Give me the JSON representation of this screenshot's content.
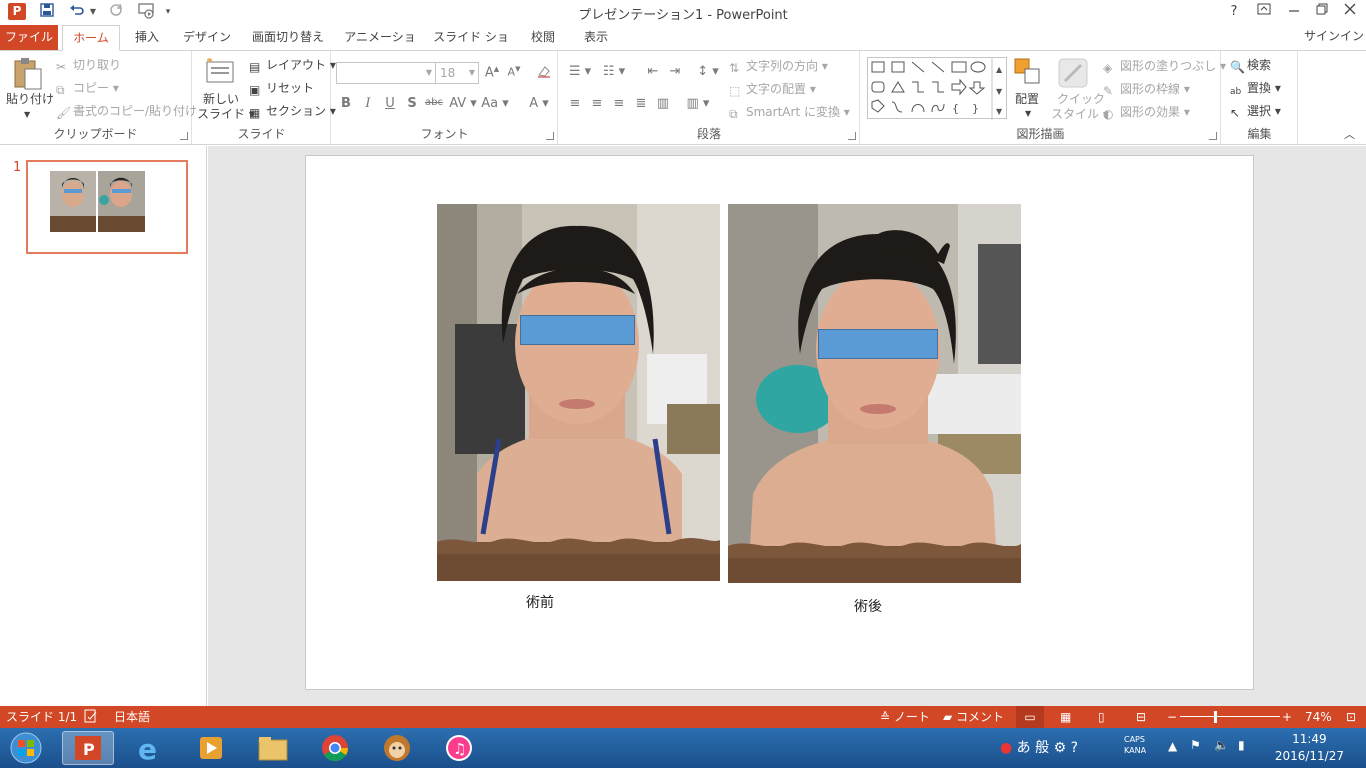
{
  "titlebar": {
    "app_icon": "P",
    "title": "プレゼンテーション1 - PowerPoint",
    "help": "?",
    "ribbon_display": "ribbon-display-icon",
    "minimize": "minimize-icon",
    "restore": "restore-icon",
    "close": "close-icon"
  },
  "tabs": {
    "file": "ファイル",
    "home": "ホーム",
    "insert": "挿入",
    "design": "デザイン",
    "transitions": "画面切り替え",
    "animations": "アニメーション",
    "slideshow": "スライド ショー",
    "review": "校閲",
    "view": "表示",
    "signin": "サインイン"
  },
  "ribbon": {
    "clipboard": {
      "label": "クリップボード",
      "paste": "貼り付け",
      "cut": "切り取り",
      "copy": "コピー",
      "format_painter": "書式のコピー/貼り付け"
    },
    "slides": {
      "label": "スライド",
      "new_slide_1": "新しい",
      "new_slide_2": "スライド",
      "layout": "レイアウト",
      "reset": "リセット",
      "section": "セクション"
    },
    "font": {
      "label": "フォント",
      "font_name": "",
      "font_size": "18"
    },
    "paragraph": {
      "label": "段落",
      "text_direction": "文字列の方向",
      "align_text": "文字の配置",
      "smartart": "SmartArt に変換"
    },
    "drawing": {
      "label": "図形描画",
      "arrange": "配置",
      "quick_styles_1": "クイック",
      "quick_styles_2": "スタイル",
      "shape_fill": "図形の塗りつぶし",
      "shape_outline": "図形の枠線",
      "shape_effects": "図形の効果"
    },
    "editing": {
      "label": "編集",
      "find": "検索",
      "replace": "置換",
      "select": "選択"
    }
  },
  "slide_pane": {
    "slide_number": "1"
  },
  "slide": {
    "caption_before": "術前",
    "caption_after": "術後"
  },
  "statusbar": {
    "slide_info": "スライド 1/1",
    "language": "日本語",
    "notes": "ノート",
    "comments": "コメント",
    "zoom": "74%"
  },
  "taskbar": {
    "ime_1": "あ",
    "ime_2": "般",
    "caps": "CAPS",
    "kana": "KANA",
    "time": "11:49",
    "date": "2016/11/27"
  },
  "colors": {
    "accent": "#d24726",
    "blur_bar": "#5b9bd5"
  }
}
